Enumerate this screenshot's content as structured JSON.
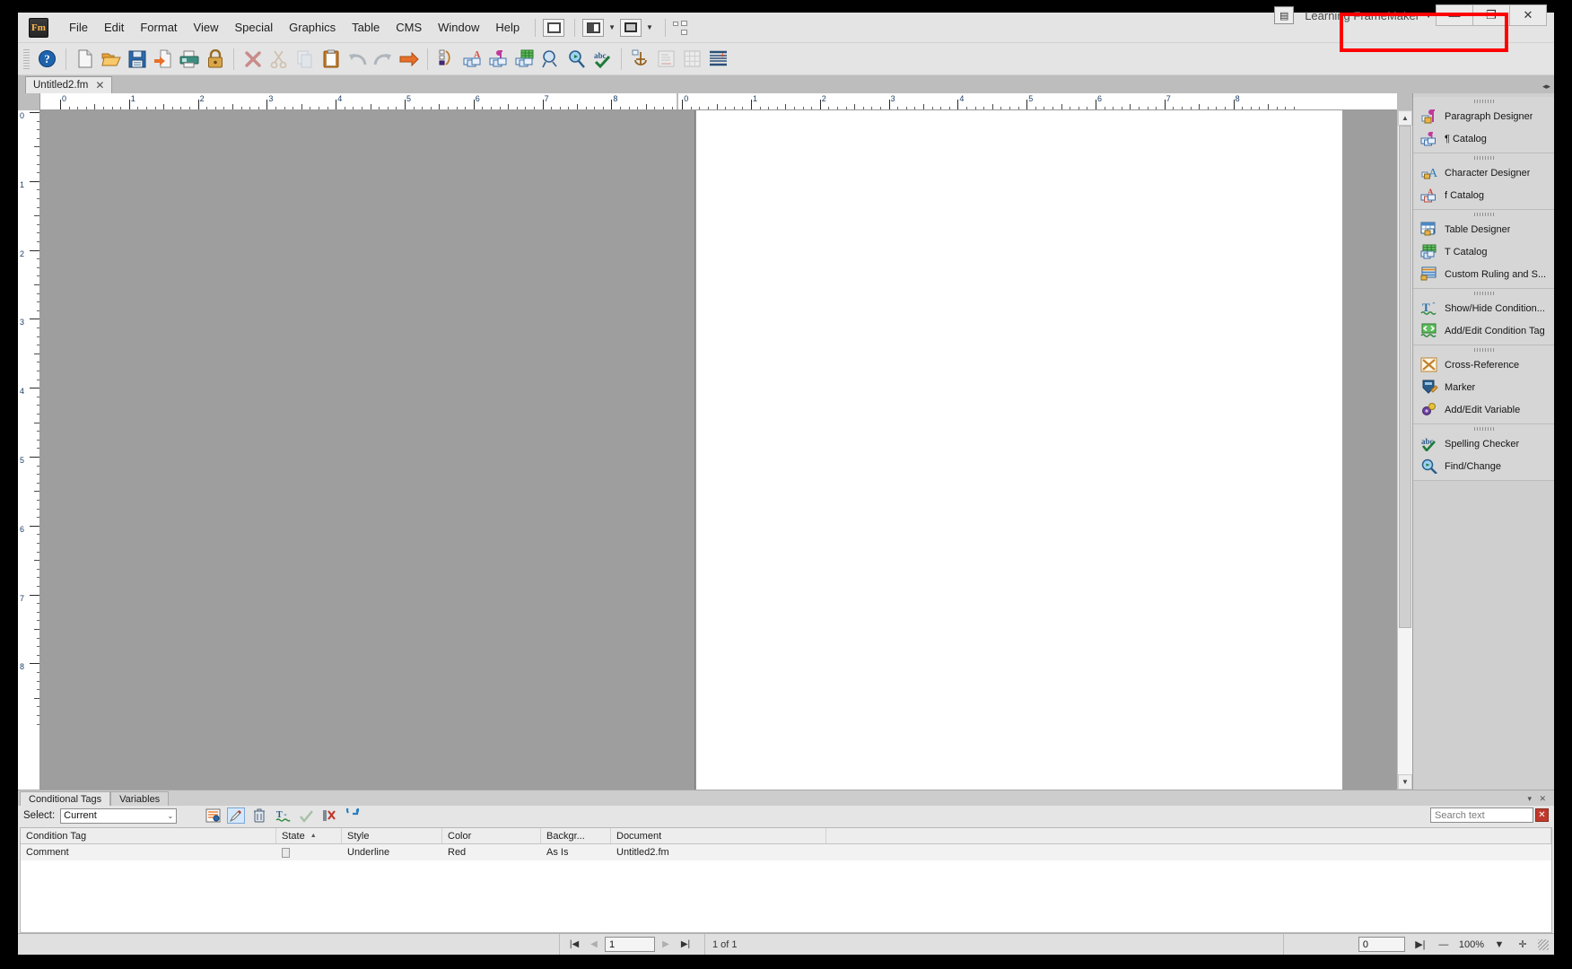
{
  "app": {
    "logo_text": "Fm",
    "workspace_name": "Learning FrameMaker",
    "window_buttons": {
      "minimize": "—",
      "restore": "❐",
      "close": "✕"
    }
  },
  "menu": {
    "items": [
      "File",
      "Edit",
      "Format",
      "View",
      "Special",
      "Graphics",
      "Table",
      "CMS",
      "Window",
      "Help"
    ]
  },
  "toolbar": {
    "groups": [
      {
        "buttons": [
          {
            "name": "help-icon",
            "tip": "Help"
          }
        ]
      },
      {
        "buttons": [
          {
            "name": "new-document-icon",
            "tip": "New"
          },
          {
            "name": "open-folder-icon",
            "tip": "Open"
          },
          {
            "name": "save-icon",
            "tip": "Save"
          },
          {
            "name": "import-icon",
            "tip": "Import"
          },
          {
            "name": "print-icon",
            "tip": "Print"
          },
          {
            "name": "lock-icon",
            "tip": "Lock"
          }
        ]
      },
      {
        "buttons": [
          {
            "name": "delete-icon",
            "tip": "Delete"
          },
          {
            "name": "cut-icon",
            "tip": "Cut"
          },
          {
            "name": "copy-icon",
            "tip": "Copy"
          },
          {
            "name": "paste-icon",
            "tip": "Paste"
          },
          {
            "name": "undo-icon",
            "tip": "Undo"
          },
          {
            "name": "redo-icon",
            "tip": "Redo"
          },
          {
            "name": "quick-access-icon",
            "tip": "Quick Access"
          }
        ]
      },
      {
        "buttons": [
          {
            "name": "structure-view-icon",
            "tip": "Structure"
          },
          {
            "name": "character-catalog-icon",
            "tip": "Character Catalog"
          },
          {
            "name": "paragraph-catalog-icon",
            "tip": "Paragraph Catalog"
          },
          {
            "name": "table-catalog-icon",
            "tip": "Table Catalog"
          },
          {
            "name": "zoom-in-icon",
            "tip": "Zoom"
          },
          {
            "name": "find-icon",
            "tip": "Find"
          },
          {
            "name": "spelling-icon",
            "tip": "Spelling Checker"
          }
        ]
      },
      {
        "buttons": [
          {
            "name": "anchored-frame-icon",
            "tip": "Anchored Frame"
          },
          {
            "name": "insert-text-frame-icon",
            "tip": "Text Frame"
          },
          {
            "name": "insert-table-icon",
            "tip": "Insert Table"
          },
          {
            "name": "paragraph-format-icon",
            "tip": "Paragraph Format"
          }
        ]
      }
    ],
    "layout_buttons": [
      {
        "name": "toggle-panel-icon",
        "label": ""
      },
      {
        "name": "split-view-icon",
        "label": ""
      },
      {
        "name": "screen-mode-icon",
        "label": ""
      },
      {
        "name": "pod-tree-icon",
        "label": ""
      }
    ]
  },
  "document_tabs": [
    {
      "label": "Untitled2.fm",
      "close": "✕",
      "active": true
    }
  ],
  "ruler": {
    "horizontal_left": [
      "0",
      "1",
      "2",
      "3",
      "4",
      "5",
      "6",
      "7",
      "8"
    ],
    "horizontal_right": [
      "0",
      "1",
      "2",
      "3",
      "4",
      "5",
      "6",
      "7",
      "8"
    ],
    "vertical": [
      "0",
      "1",
      "2",
      "3",
      "4",
      "5",
      "6",
      "7",
      "8"
    ],
    "unit": "inches"
  },
  "canvas": {
    "paragraph_symbol": "¶"
  },
  "right_panel": {
    "groups": [
      {
        "items": [
          {
            "label": "Paragraph Designer",
            "icon": "paragraph-designer-icon"
          },
          {
            "label": "¶ Catalog",
            "icon": "paragraph-catalog-icon"
          }
        ]
      },
      {
        "items": [
          {
            "label": "Character Designer",
            "icon": "character-designer-icon"
          },
          {
            "label": "f Catalog",
            "icon": "character-catalog-icon"
          }
        ]
      },
      {
        "items": [
          {
            "label": "Table Designer",
            "icon": "table-designer-icon"
          },
          {
            "label": "T Catalog",
            "icon": "table-catalog-icon"
          },
          {
            "label": "Custom Ruling and S...",
            "icon": "custom-ruling-icon"
          }
        ]
      },
      {
        "items": [
          {
            "label": "Show/Hide Condition...",
            "icon": "show-hide-condition-icon"
          },
          {
            "label": "Add/Edit Condition Tag",
            "icon": "add-edit-condition-tag-icon"
          }
        ]
      },
      {
        "items": [
          {
            "label": "Cross-Reference",
            "icon": "cross-reference-icon"
          },
          {
            "label": "Marker",
            "icon": "marker-icon"
          },
          {
            "label": "Add/Edit Variable",
            "icon": "add-edit-variable-icon"
          }
        ]
      },
      {
        "items": [
          {
            "label": "Spelling Checker",
            "icon": "spelling-checker-icon"
          },
          {
            "label": "Find/Change",
            "icon": "find-change-icon"
          }
        ]
      }
    ]
  },
  "dock": {
    "tabs": [
      {
        "label": "Conditional Tags",
        "active": true
      },
      {
        "label": "Variables",
        "active": false
      }
    ],
    "select_label": "Select:",
    "select_value": "Current",
    "select_caret": "⌄",
    "buttons": [
      {
        "name": "new-condition-tag-icon",
        "state": "normal"
      },
      {
        "name": "edit-condition-tag-icon",
        "state": "active"
      },
      {
        "name": "delete-condition-tag-icon",
        "state": "normal"
      },
      {
        "name": "apply-condition-tag-icon",
        "state": "normal"
      },
      {
        "name": "check-apply-icon",
        "state": "disabled"
      },
      {
        "name": "remove-condition-icon",
        "state": "normal"
      },
      {
        "name": "refresh-icon",
        "state": "normal"
      }
    ],
    "search": {
      "placeholder": "Search text",
      "value": "",
      "clear_label": "✕"
    },
    "table": {
      "columns": [
        "Condition Tag",
        "State",
        "Style",
        "Color",
        "Backgr...",
        "Document"
      ],
      "sort_column": "State",
      "sort_indicator": "▲",
      "rows": [
        {
          "condition_tag": "Comment",
          "state": "",
          "style": "Underline",
          "color": "Red",
          "background": "As Is",
          "document": "Untitled2.fm"
        }
      ]
    }
  },
  "status_bar": {
    "first_page": "|◀",
    "prev_page": "◀",
    "page_value": "1",
    "next_page": "▶",
    "last_page": "▶|",
    "page_of": "1 of 1",
    "flow_value": "0",
    "flow_icon": "▶|",
    "minus": "—",
    "zoom_value": "100%",
    "zoom_caret": "▼",
    "plus": "✛"
  },
  "colors": {
    "chrome": "#e4e4e4",
    "canvas_gray": "#9e9e9e",
    "panel_gray": "#cfcfcf",
    "annotation_red": "#ff0000",
    "accent_blue": "#1c5c9e"
  }
}
